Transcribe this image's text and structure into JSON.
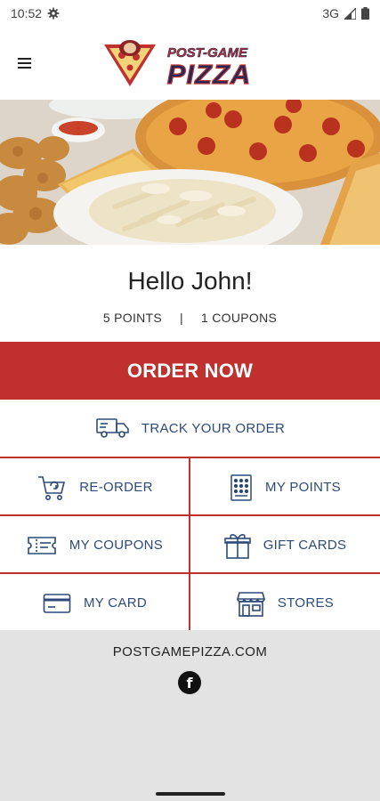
{
  "status": {
    "time": "10:52",
    "network": "3G"
  },
  "header": {
    "logo_top": "POST-GAME",
    "logo_bottom": "PIZZA"
  },
  "greeting": "Hello John!",
  "stats": {
    "points": "5 POINTS",
    "separator": "|",
    "coupons": "1 COUPONS"
  },
  "order_now": "ORDER NOW",
  "track_order": "TRACK YOUR ORDER",
  "grid": {
    "reorder": "RE-ORDER",
    "my_points": "MY POINTS",
    "my_coupons": "MY COUPONS",
    "gift_cards": "GIFT CARDS",
    "my_card": "MY CARD",
    "stores": "STORES"
  },
  "footer": {
    "website": "POSTGAMEPIZZA.COM",
    "facebook": "f"
  },
  "colors": {
    "brand_red": "#c0302f",
    "link_blue": "#2d4a78",
    "footer_bg": "#e3e3e3"
  }
}
